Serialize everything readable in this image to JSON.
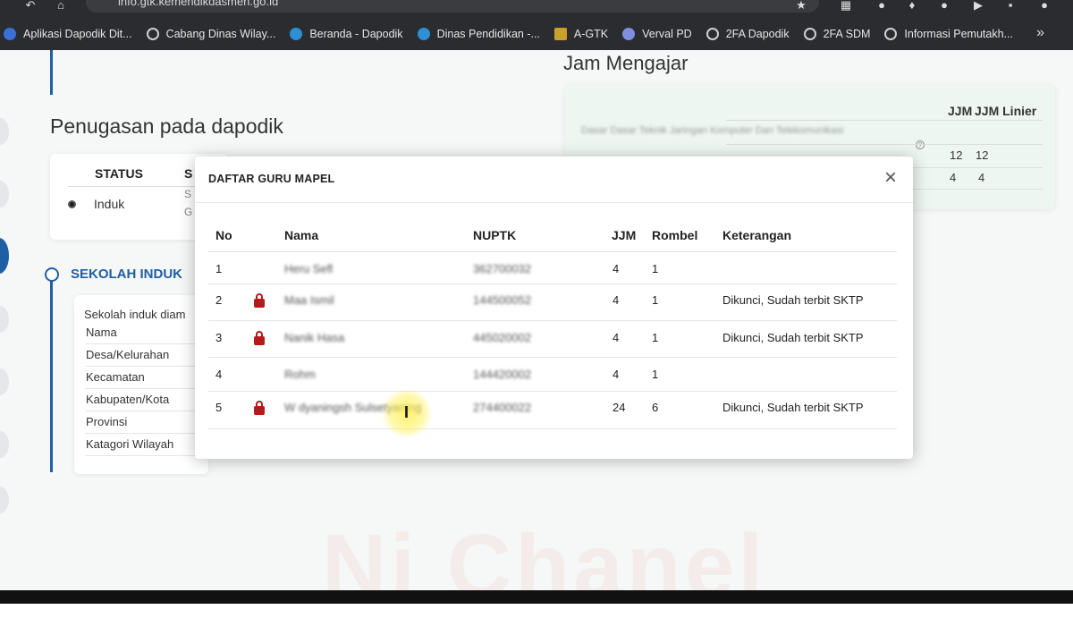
{
  "browser": {
    "url": "info.gtk.kemendikdasmen.go.id",
    "bookmarks": [
      {
        "label": "Aplikasi Dapodik Dit...",
        "icon": "blue"
      },
      {
        "label": "Cabang Dinas Wilay...",
        "icon": "globe"
      },
      {
        "label": "Beranda - Dapodik",
        "icon": "ed"
      },
      {
        "label": "Dinas Pendidikan -...",
        "icon": "ed"
      },
      {
        "label": "A-GTK",
        "icon": "gold"
      },
      {
        "label": "Verval PD",
        "icon": "person"
      },
      {
        "label": "2FA Dapodik",
        "icon": "globe"
      },
      {
        "label": "2FA SDM",
        "icon": "globe"
      },
      {
        "label": "Informasi Pemutakh...",
        "icon": "globe"
      }
    ],
    "more": "»"
  },
  "page": {
    "penugasan_title": "Penugasan pada dapodik",
    "status": {
      "header": "STATUS",
      "header2": "S",
      "value": "Induk",
      "s1": "S",
      "s2": "G"
    },
    "sekolah": {
      "title": "SEKOLAH INDUK",
      "intro": "Sekolah induk diam",
      "fields": [
        "Nama",
        "Desa/Kelurahan",
        "Kecamatan",
        "Kabupaten/Kota",
        "Provinsi",
        "Katagori Wilayah"
      ]
    },
    "jam": {
      "title": "Jam Mengajar",
      "jjm_header": "JJM",
      "jjm_linier_header": "JJM Linier",
      "row1_label": "Dasar Dasar Teknik Jaringan Komputer Dan Telekomunikasi",
      "row1_jjm": "12",
      "row1_linier": "12",
      "row2_jjm": "4",
      "row2_linier": "4"
    },
    "watermark": "Ni Chanel"
  },
  "modal": {
    "title": "DAFTAR GURU MAPEL",
    "close": "×",
    "headers": {
      "no": "No",
      "nama": "Nama",
      "nuptk": "NUPTK",
      "jjm": "JJM",
      "rombel": "Rombel",
      "keterangan": "Keterangan"
    },
    "rows": [
      {
        "no": "1",
        "nama": "Heru Sefl",
        "nuptk": "362700032",
        "jjm": "4",
        "rombel": "1",
        "keterangan": "",
        "locked": false
      },
      {
        "no": "2",
        "nama": "Maa Ismil",
        "nuptk": "144500052",
        "jjm": "4",
        "rombel": "1",
        "keterangan": "Dikunci, Sudah terbit SKTP",
        "locked": true
      },
      {
        "no": "3",
        "nama": "Nanik Hasa",
        "nuptk": "445020002",
        "jjm": "4",
        "rombel": "1",
        "keterangan": "Dikunci, Sudah terbit SKTP",
        "locked": true
      },
      {
        "no": "4",
        "nama": "Rohm",
        "nuptk": "144420002",
        "jjm": "4",
        "rombel": "1",
        "keterangan": "",
        "locked": false
      },
      {
        "no": "5",
        "nama": "W dyaningsh Sulsetyaning",
        "nuptk": "274400022",
        "jjm": "24",
        "rombel": "6",
        "keterangan": "Dikunci, Sudah terbit SKTP",
        "locked": true
      }
    ]
  }
}
